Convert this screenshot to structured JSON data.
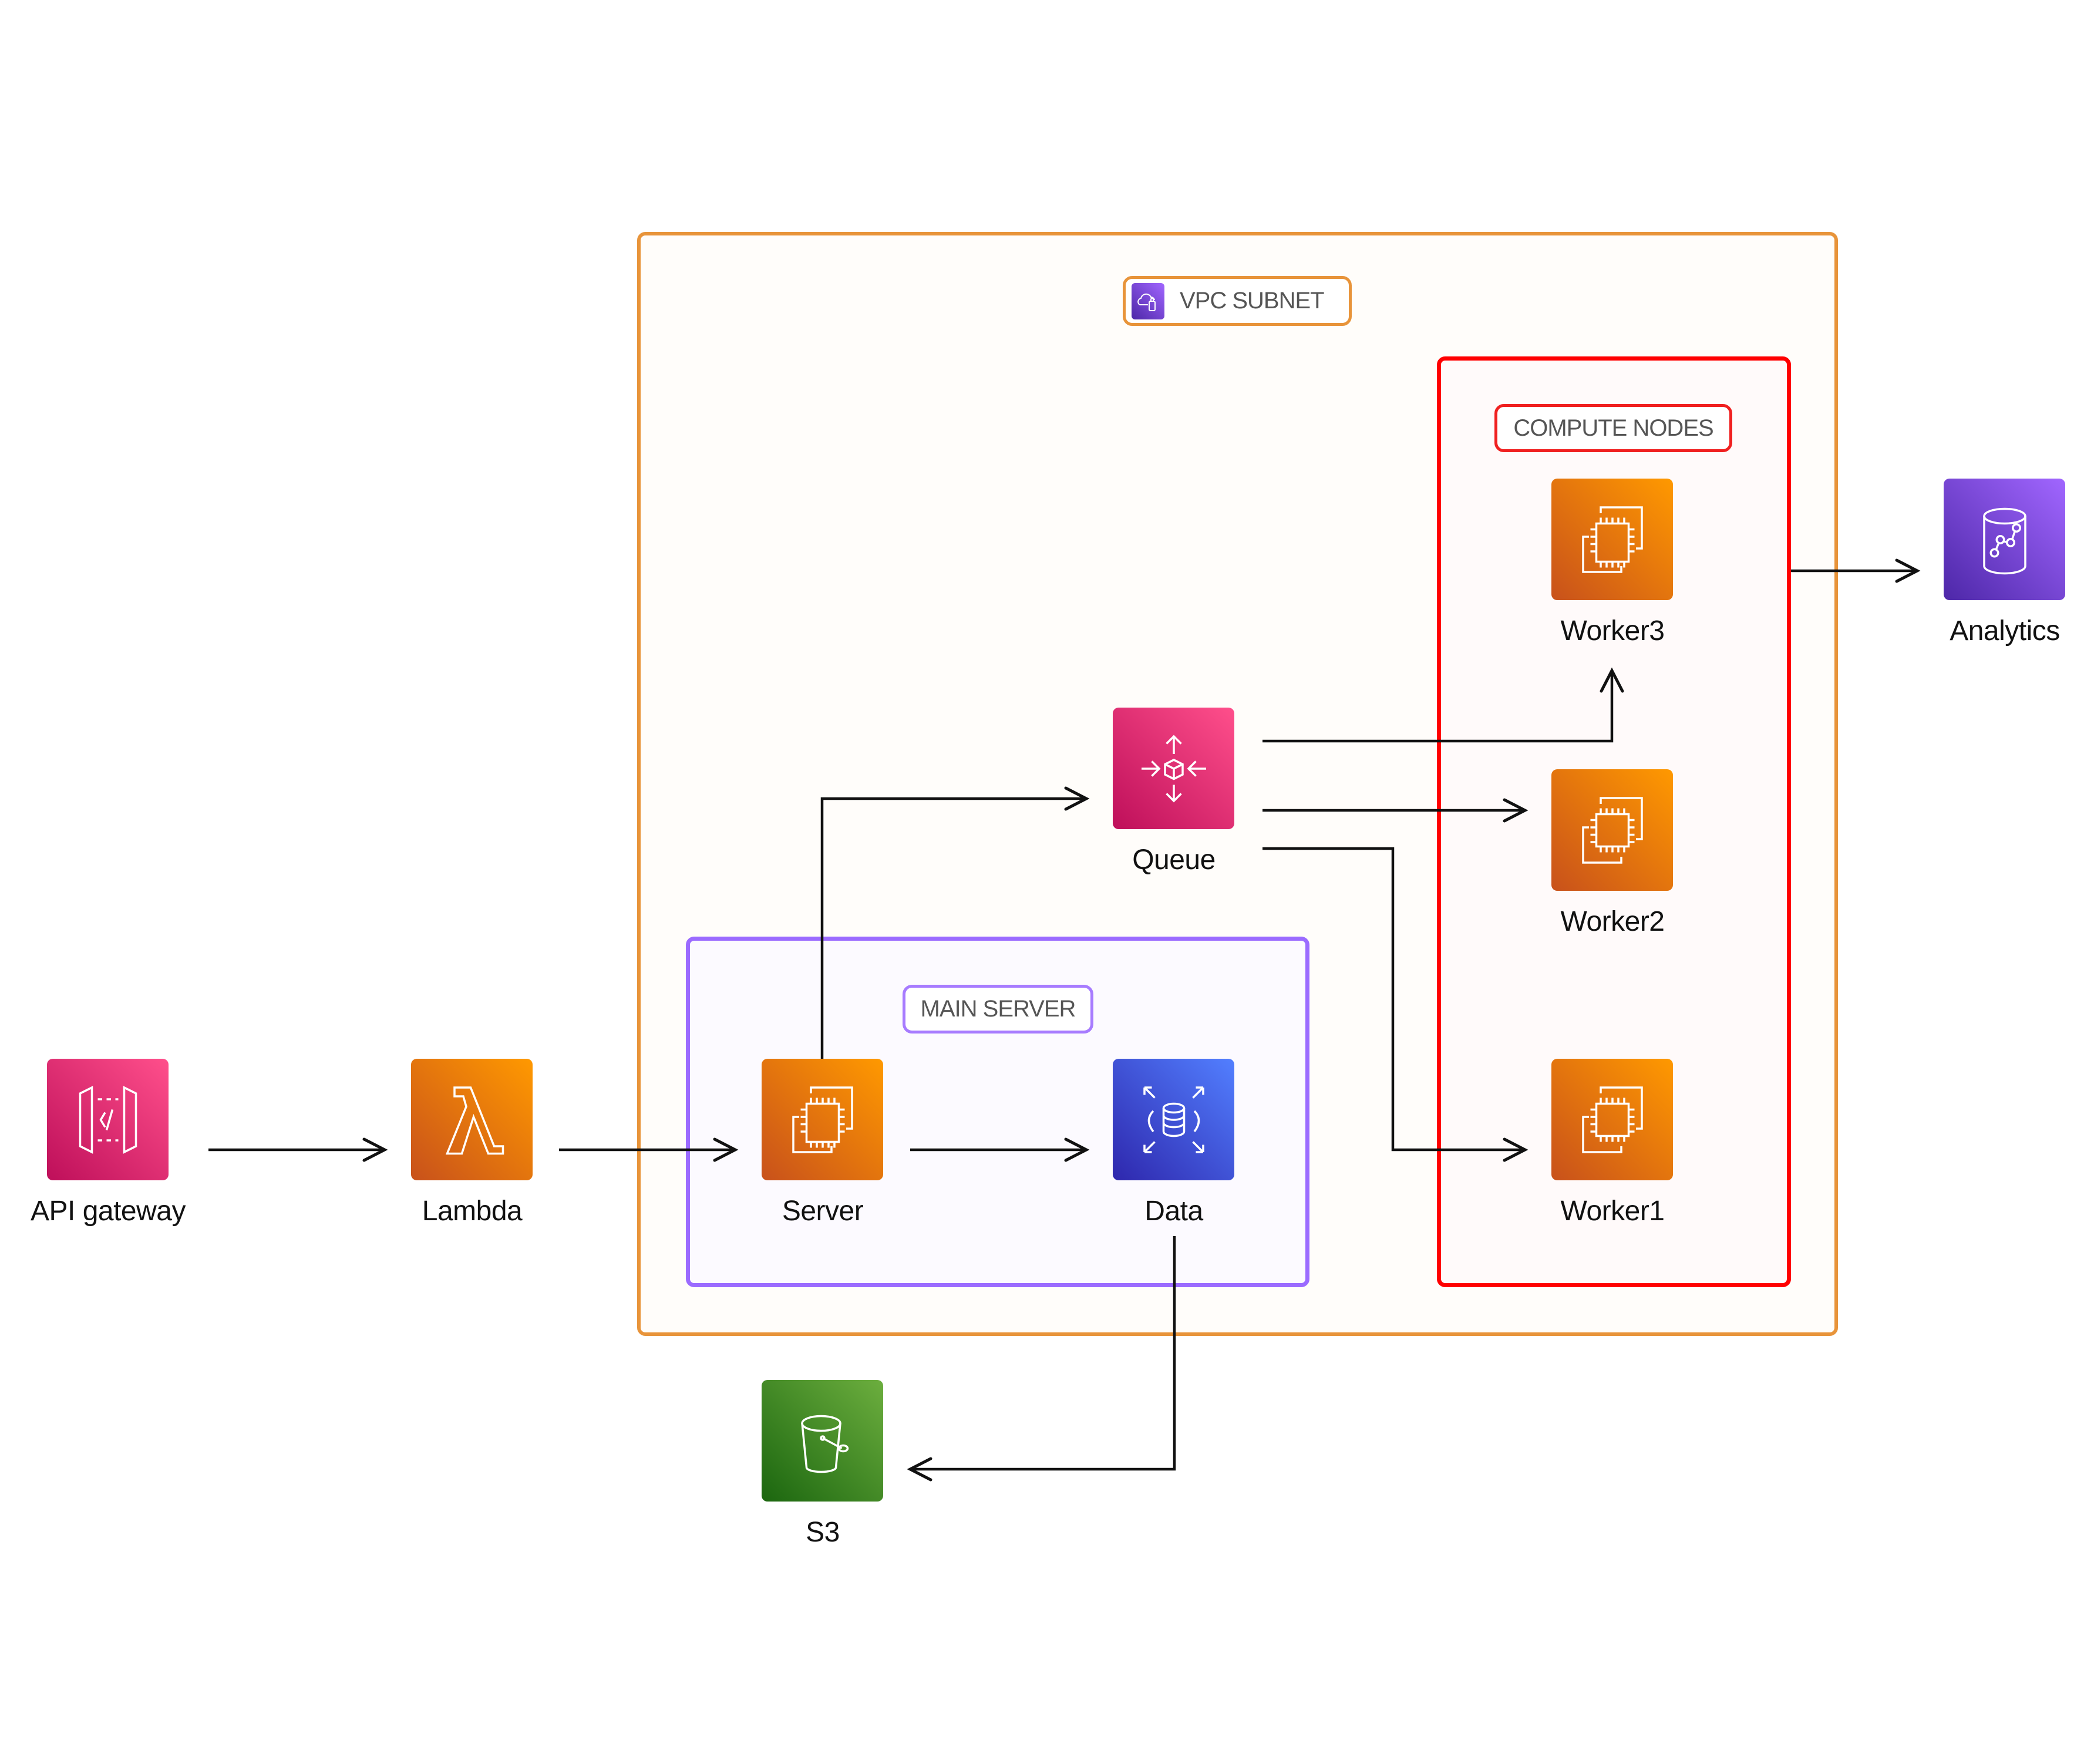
{
  "groups": {
    "vpc": {
      "label": "VPC SUBNET",
      "icon": "vpc-cloud-icon",
      "border_color": "#E8943A"
    },
    "compute": {
      "label": "COMPUTE NODES",
      "border_color": "#FF0000"
    },
    "main_server": {
      "label": "MAIN SERVER",
      "border_color": "#9B6BFF"
    }
  },
  "nodes": {
    "api_gateway": {
      "label": "API gateway",
      "icon": "api-gateway-icon",
      "color": "#E7157B"
    },
    "lambda": {
      "label": "Lambda",
      "icon": "lambda-icon",
      "color": "#ED7100"
    },
    "server": {
      "label": "Server",
      "icon": "ec2-instance-icon",
      "color": "#ED7100"
    },
    "data": {
      "label": "Data",
      "icon": "rds-database-icon",
      "color": "#3B48CC"
    },
    "queue": {
      "label": "Queue",
      "icon": "sqs-queue-icon",
      "color": "#E7157B"
    },
    "worker3": {
      "label": "Worker3",
      "icon": "ec2-instance-icon",
      "color": "#ED7100"
    },
    "worker2": {
      "label": "Worker2",
      "icon": "ec2-instance-icon",
      "color": "#ED7100"
    },
    "worker1": {
      "label": "Worker1",
      "icon": "ec2-instance-icon",
      "color": "#ED7100"
    },
    "analytics": {
      "label": "Analytics",
      "icon": "analytics-icon",
      "color": "#8C4FFF"
    },
    "s3": {
      "label": "S3",
      "icon": "s3-bucket-icon",
      "color": "#3F8624"
    }
  },
  "edges": [
    {
      "from": "API gateway",
      "to": "Lambda"
    },
    {
      "from": "Lambda",
      "to": "Server"
    },
    {
      "from": "Server",
      "to": "Data"
    },
    {
      "from": "Server",
      "to": "Queue"
    },
    {
      "from": "Queue",
      "to": "Worker3"
    },
    {
      "from": "Queue",
      "to": "Worker2"
    },
    {
      "from": "Queue",
      "to": "Worker1"
    },
    {
      "from": "COMPUTE NODES",
      "to": "Analytics"
    },
    {
      "from": "Data",
      "to": "S3"
    }
  ]
}
